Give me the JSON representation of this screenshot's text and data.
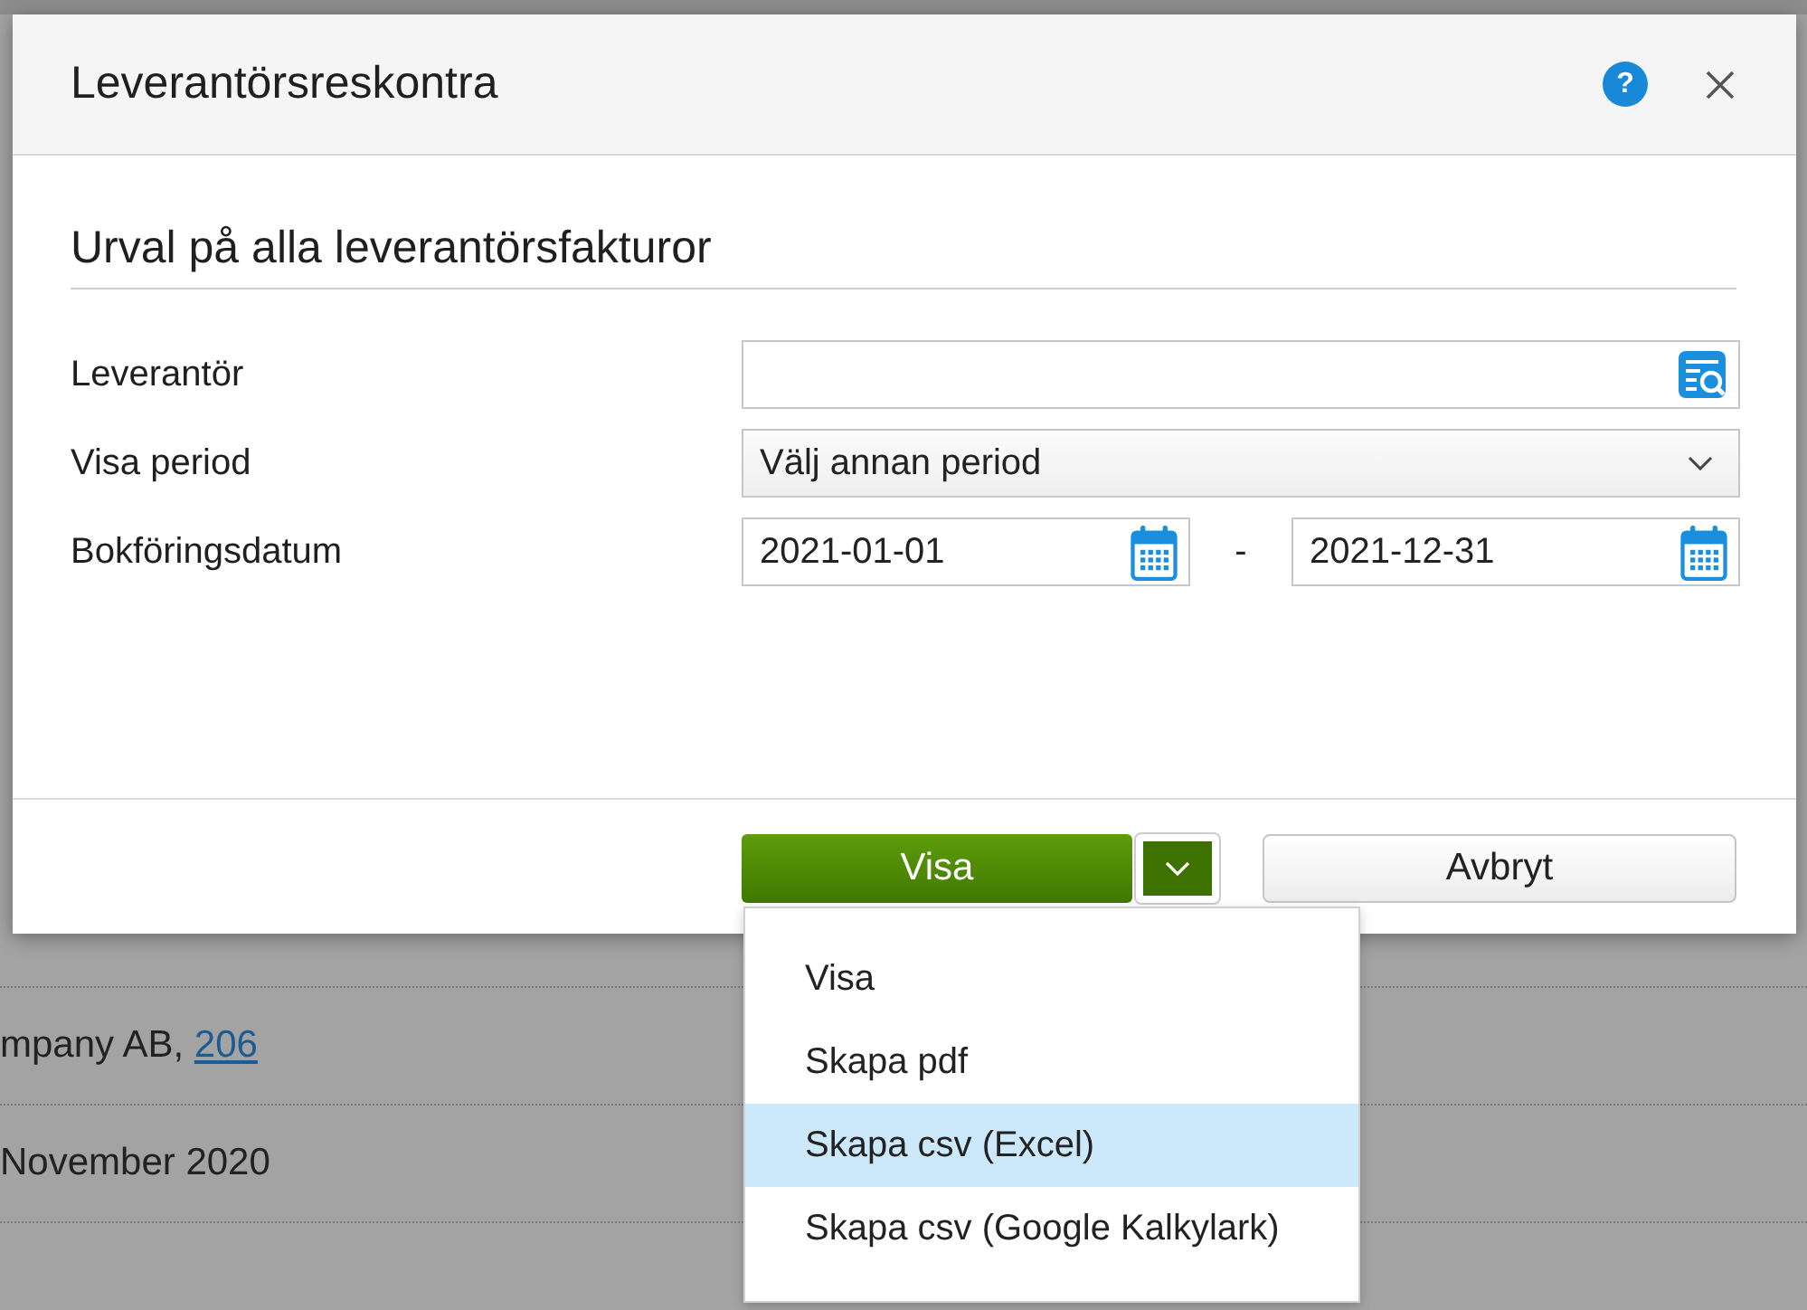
{
  "window": {
    "title": "Leverantörsreskontra",
    "help": "?"
  },
  "section_title": "Urval på alla leverantörsfakturor",
  "fields": [
    {
      "kind": "search",
      "label": "Leverantör"
    },
    {
      "kind": "select",
      "label": "Visa period",
      "value": "Välj annan period"
    },
    {
      "kind": "daterange",
      "label": "Bokföringsdatum",
      "from": "2021-01-01",
      "separator": "-",
      "to": "2021-12-31"
    }
  ],
  "buttons": [
    {
      "kind": "split",
      "label": "Visa",
      "expanded": true,
      "menu": [
        {
          "label": "Visa",
          "selected": false
        },
        {
          "label": "Skapa pdf",
          "selected": false
        },
        {
          "label": "Skapa csv (Excel)",
          "selected": true
        },
        {
          "label": "Skapa csv (Google Kalkylark)",
          "selected": false
        }
      ]
    },
    {
      "kind": "plain",
      "label": "Avbryt"
    }
  ],
  "background_rows": [
    {
      "text": "mpany AB, ",
      "link": "206"
    },
    {
      "text": "November 2020"
    }
  ]
}
